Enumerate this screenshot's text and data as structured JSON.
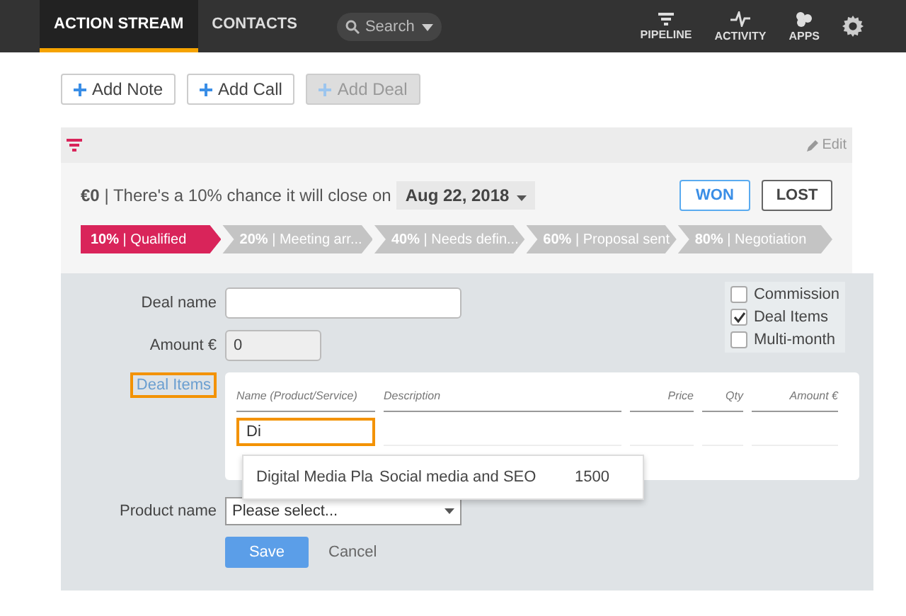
{
  "nav": {
    "tabs": [
      {
        "label": "ACTION STREAM",
        "selected": true
      },
      {
        "label": "CONTACTS",
        "selected": false
      }
    ],
    "search": {
      "placeholder": "Search"
    },
    "apps": [
      {
        "label": "PIPELINE",
        "kind": "pipeline"
      },
      {
        "label": "ACTIVITY",
        "kind": "activity"
      },
      {
        "label": "APPS",
        "kind": "apps"
      }
    ]
  },
  "actions": [
    {
      "label": "Add Note",
      "disabled": false
    },
    {
      "label": "Add Call",
      "disabled": false
    },
    {
      "label": "Add Deal",
      "disabled": true
    }
  ],
  "deal": {
    "edit": "Edit",
    "summary": {
      "amount": "€0",
      "text": "| There's a 10% chance it will close on",
      "date": "Aug 22, 2018"
    },
    "outcome_buttons": [
      {
        "label": "WON",
        "selected": true
      },
      {
        "label": "LOST",
        "selected": false
      }
    ],
    "stages": [
      {
        "percent": "10%",
        "label": "| Qualified",
        "selected": true
      },
      {
        "percent": "20%",
        "label": "| Meeting arr...",
        "selected": false
      },
      {
        "percent": "40%",
        "label": "| Needs defin...",
        "selected": false
      },
      {
        "percent": "60%",
        "label": "| Proposal sent",
        "selected": false
      },
      {
        "percent": "80%",
        "label": "| Negotiation",
        "selected": false
      }
    ]
  },
  "form": {
    "deal_name": {
      "label": "Deal name"
    },
    "amount": {
      "label": "Amount €",
      "value": "0"
    },
    "options": [
      {
        "label": "Commission",
        "checked": false
      },
      {
        "label": "Deal Items",
        "checked": true
      },
      {
        "label": "Multi-month",
        "checked": false
      }
    ],
    "deal_items": {
      "label": "Deal Items",
      "columns": [
        "Name (Product/Service)",
        "Description",
        "Price",
        "Qty",
        "Amount €"
      ],
      "name_value": "Di",
      "suggestion": {
        "name": "Digital Media Pla",
        "description": "Social media and SEO",
        "price": "1500"
      }
    },
    "product_name": {
      "label": "Product name",
      "value": "Please select..."
    },
    "buttons": {
      "save": "Save",
      "cancel": "Cancel"
    }
  }
}
